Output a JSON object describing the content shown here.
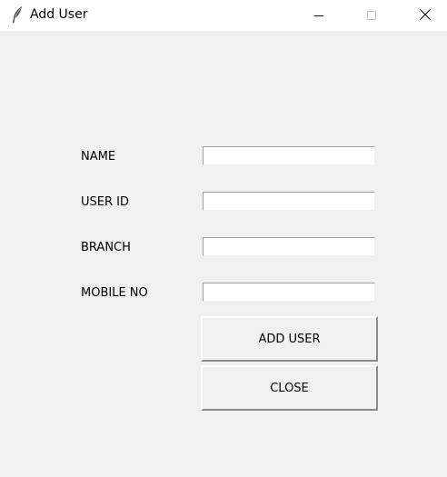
{
  "window": {
    "title": "Add User"
  },
  "form": {
    "fields": [
      {
        "label": "NAME",
        "value": ""
      },
      {
        "label": "USER ID",
        "value": ""
      },
      {
        "label": "BRANCH",
        "value": ""
      },
      {
        "label": "MOBILE NO",
        "value": ""
      }
    ],
    "add_user_label": "ADD USER",
    "close_label": "CLOSE"
  },
  "icons": {
    "app": "feather-icon",
    "minimize": "minimize-icon",
    "maximize": "maximize-icon",
    "close": "close-icon"
  },
  "colors": {
    "background": "#f0f0f0",
    "titlebar": "#ffffff"
  }
}
